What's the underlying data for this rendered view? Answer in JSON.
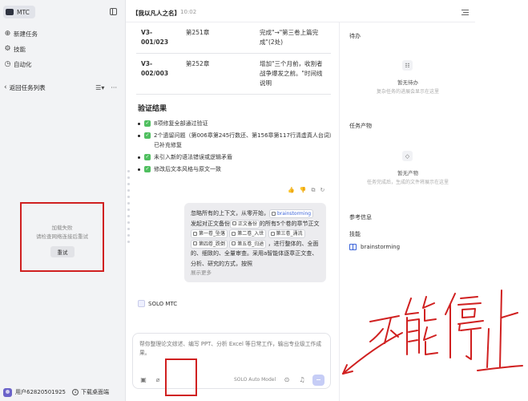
{
  "sidebar": {
    "logo_text": "MTC",
    "nav": [
      {
        "label": "新建任务",
        "icon": "chat-plus-icon"
      },
      {
        "label": "技能",
        "icon": "skill-icon"
      },
      {
        "label": "自动化",
        "icon": "clock-icon"
      }
    ],
    "section_title": "返回任务列表",
    "load_fail_title": "加载失败",
    "load_fail_hint": "请检查网络连接后重试",
    "retry_label": "重试",
    "user_name": "用户62820501925",
    "download_label": "下载桌面端"
  },
  "header": {
    "title": "【我以凡人之名】",
    "time": "10:02"
  },
  "chapter_table": [
    {
      "vol": "V3-001/023",
      "chapter": "第251章",
      "change": "完成\"→\"第三卷上篇完成\"(2处)"
    },
    {
      "vol": "V3-002/003",
      "chapter": "第252章",
      "change": "增加\"三个月前，收割者战争爆发之前。\"时间线说明"
    }
  ],
  "verify": {
    "title": "验证结果",
    "items": [
      "8项修复全部通过验证",
      "2个遗留问题（第006章第245行数还、第156章第117行清虚真人台词）已补充修复",
      "未引入新的语法错误或逻辑矛盾",
      "修改后文本风格与原文一致"
    ]
  },
  "user_message": {
    "text1": "忽略所有的上下文，从零开始，",
    "tag_skill": "brainstorming",
    "text2": "发起对正文备份",
    "tag_backup": "正文备份",
    "text3": "的所有5个卷的章节正文",
    "vol_tags": [
      "第一卷_坠落",
      "第二卷_入世",
      "第三卷_涌流",
      "第四卷_跌倒",
      "第五卷_归途"
    ],
    "text4": "，进行整体的、全面的、细致的、全量审查。采用a智能体逐章正文查、分析、研究的方式，按照",
    "show_more": "展示更多"
  },
  "agent_label": "SOLO MTC",
  "composer": {
    "placeholder": "帮你整理论文综述、编写 PPT、分析 Excel 等日常工作，输出专业级工作成果。",
    "model": "SOLO Auto Model"
  },
  "right_panel": {
    "todo_title": "待办",
    "todo_empty": "暂无待办",
    "todo_sub": "复杂任务的进展会显示在这里",
    "output_title": "任务产物",
    "output_empty": "暂无产物",
    "output_sub": "任务完成后，生成的文件将展示在这里",
    "ref_title": "参考信息",
    "skill_title": "技能",
    "skill_item": "brainstorming"
  },
  "annotation": {
    "handwritten_text": "不能停止",
    "color": "#d02020"
  }
}
